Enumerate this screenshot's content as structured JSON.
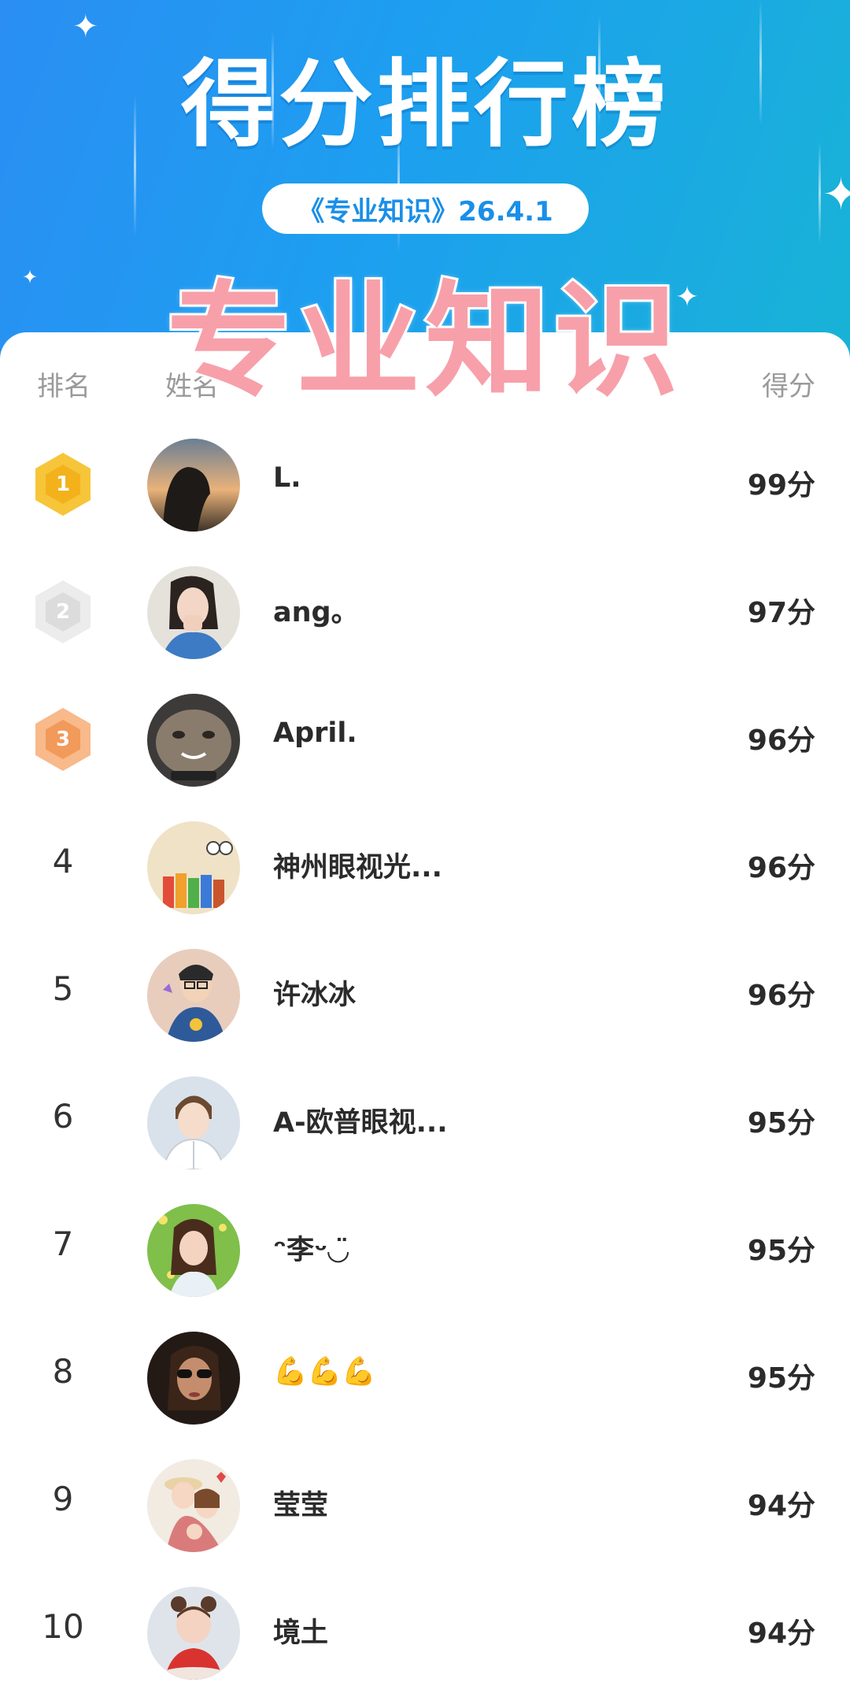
{
  "header": {
    "title": "得分排行榜",
    "subtitle": "《专业知识》26.4.1",
    "overlay_text": "专业知识"
  },
  "columns": {
    "rank": "排名",
    "name": "姓名",
    "score": "得分"
  },
  "rows": [
    {
      "rank": "1",
      "medal": "gold",
      "name": "L.",
      "score": "99分",
      "avatar": "sunset-silhouette"
    },
    {
      "rank": "2",
      "medal": "silver",
      "name": "ang。",
      "score": "97分",
      "avatar": "girl-portrait"
    },
    {
      "rank": "3",
      "medal": "bronze",
      "name": "April.",
      "score": "96分",
      "avatar": "cat-photo"
    },
    {
      "rank": "4",
      "medal": "",
      "name": "神州眼视光...",
      "score": "96分",
      "avatar": "store-logo"
    },
    {
      "rank": "5",
      "medal": "",
      "name": "许冰冰",
      "score": "96分",
      "avatar": "cartoon-man"
    },
    {
      "rank": "6",
      "medal": "",
      "name": "A-欧普眼视...",
      "score": "95分",
      "avatar": "cartoon-doctor"
    },
    {
      "rank": "7",
      "medal": "",
      "name": "ᵔ李ᵕ◡̈",
      "score": "95分",
      "avatar": "girl-flowers"
    },
    {
      "rank": "8",
      "medal": "",
      "name": "💪💪💪",
      "score": "95分",
      "avatar": "woman-sunglasses"
    },
    {
      "rank": "9",
      "medal": "",
      "name": "莹莹",
      "score": "94分",
      "avatar": "cartoon-family"
    },
    {
      "rank": "10",
      "medal": "",
      "name": "境土",
      "score": "94分",
      "avatar": "cartoon-girl-3d"
    }
  ],
  "colors": {
    "header_start": "#2a8ef3",
    "header_end": "#18b3d6",
    "pill_text": "#1a8fe8",
    "overlay_fill": "#f7a0aa",
    "gold": "#f3b21c",
    "silver": "#dcdcdc",
    "bronze": "#f19a5a"
  }
}
